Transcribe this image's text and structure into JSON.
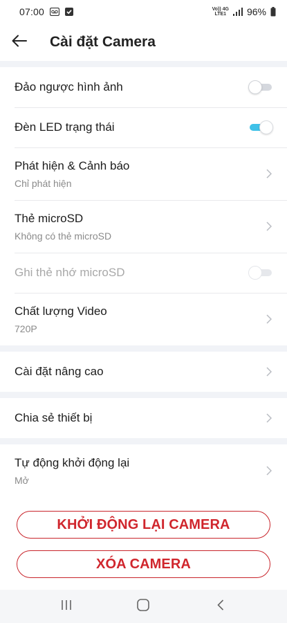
{
  "status_bar": {
    "time": "07:00",
    "network_top": "Vo)) 4G",
    "network_bottom": "LTE1",
    "battery": "96%"
  },
  "app_bar": {
    "title": "Cài đặt Camera"
  },
  "settings": {
    "flip_image": {
      "label": "Đảo ngược hình ảnh",
      "enabled": false
    },
    "status_led": {
      "label": "Đèn LED trạng thái",
      "enabled": true
    },
    "detection": {
      "label": "Phát hiện & Cảnh báo",
      "value": "Chỉ phát hiện"
    },
    "microsd": {
      "label": "Thẻ microSD",
      "value": "Không có thẻ microSD"
    },
    "microsd_record": {
      "label": "Ghi thẻ nhớ microSD",
      "enabled": false
    },
    "video_quality": {
      "label": "Chất lượng Video",
      "value": "720P"
    },
    "advanced": {
      "label": "Cài đặt nâng cao"
    },
    "share": {
      "label": "Chia sẻ thiết bị"
    },
    "auto_restart": {
      "label": "Tự động khởi động lại",
      "value": "Mở"
    }
  },
  "actions": {
    "restart_label": "KHỞI ĐỘNG LẠI CAMERA",
    "delete_label": "XÓA CAMERA"
  },
  "colors": {
    "accent_toggle": "#3fc1e8",
    "danger": "#d0262d",
    "background": "#f1f3f7"
  }
}
